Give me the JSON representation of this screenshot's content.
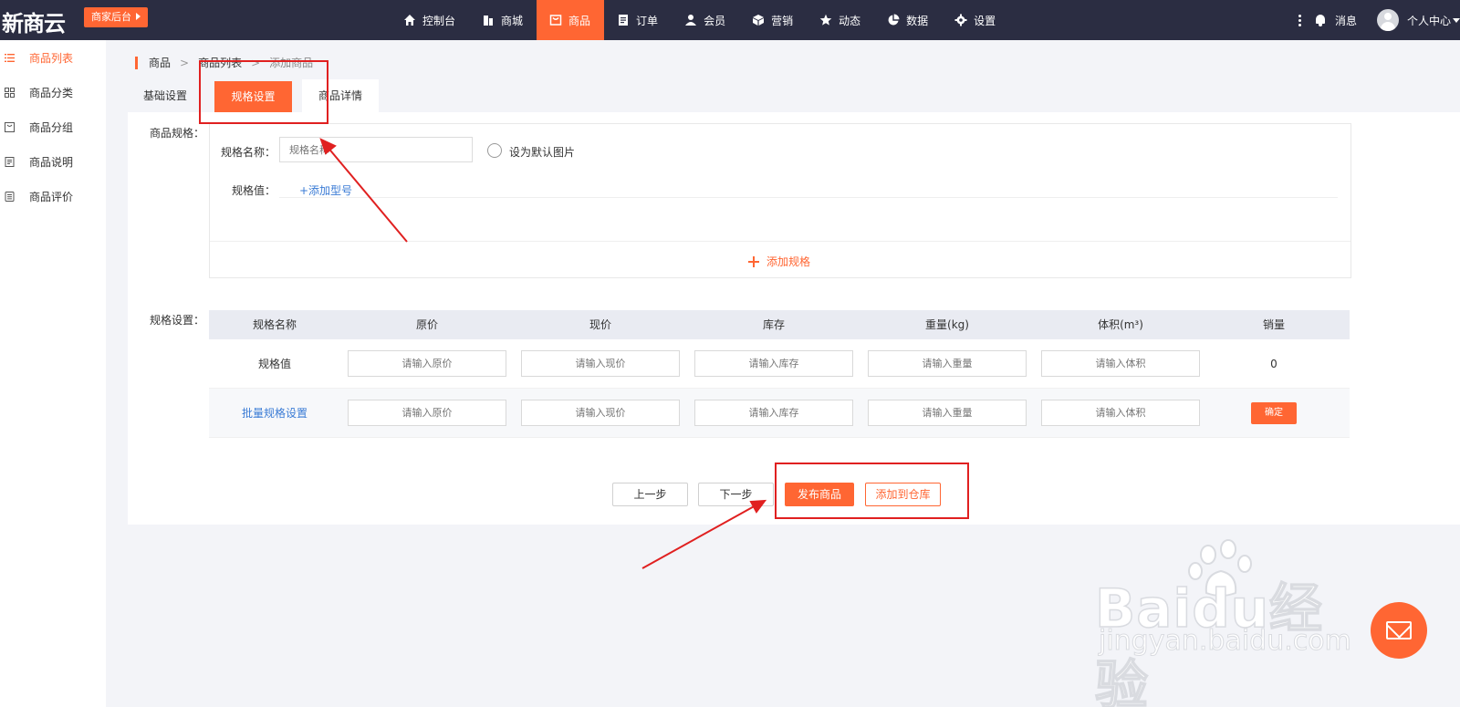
{
  "header": {
    "logo": "新商云",
    "merchant_button": "商家后台",
    "nav": [
      {
        "label": "控制台",
        "icon": "home-icon"
      },
      {
        "label": "商城",
        "icon": "building-icon"
      },
      {
        "label": "商品",
        "icon": "bag-icon",
        "active": true
      },
      {
        "label": "订单",
        "icon": "clipboard-icon"
      },
      {
        "label": "会员",
        "icon": "user-icon"
      },
      {
        "label": "营销",
        "icon": "cube-icon"
      },
      {
        "label": "动态",
        "icon": "star-icon"
      },
      {
        "label": "数据",
        "icon": "pie-chart-icon"
      },
      {
        "label": "设置",
        "icon": "gear-icon"
      }
    ],
    "messages_label": "消息",
    "user_center_label": "个人中心"
  },
  "sidebar": {
    "items": [
      {
        "label": "商品列表",
        "icon": "list-icon",
        "active": true
      },
      {
        "label": "商品分类",
        "icon": "grid-icon"
      },
      {
        "label": "商品分组",
        "icon": "folder-icon"
      },
      {
        "label": "商品说明",
        "icon": "document-icon"
      },
      {
        "label": "商品评价",
        "icon": "review-icon"
      }
    ]
  },
  "breadcrumb": [
    "商品",
    ">",
    "商品列表",
    ">",
    "添加商品"
  ],
  "tabs": [
    "基础设置",
    "规格设置",
    "商品详情"
  ],
  "spec": {
    "section_label": "商品规格：",
    "name_label": "规格名称：",
    "name_placeholder": "规格名称",
    "default_image_label": "设为默认图片",
    "value_label": "规格值：",
    "add_model_link": "+添加型号",
    "add_spec_label": "添加规格"
  },
  "spec_settings": {
    "section_label": "规格设置：",
    "columns": [
      "规格名称",
      "原价",
      "现价",
      "库存",
      "重量(kg)",
      "体积(m³)",
      "销量"
    ],
    "rows": [
      {
        "name": "规格值",
        "placeholders": [
          "请输入原价",
          "请输入现价",
          "请输入库存",
          "请输入重量",
          "请输入体积"
        ],
        "sales": "0"
      },
      {
        "name": "批量规格设置",
        "placeholders": [
          "请输入原价",
          "请输入现价",
          "请输入库存",
          "请输入重量",
          "请输入体积"
        ],
        "confirm_label": "确定"
      }
    ]
  },
  "actions": {
    "prev": "上一步",
    "next": "下一步",
    "publish": "发布商品",
    "add_to_warehouse": "添加到仓库"
  },
  "watermark": {
    "brand": "Baidu经验",
    "url": "jingyan.baidu.com"
  },
  "colors": {
    "accent": "#ff6633",
    "topbar": "#2b2d42",
    "link": "#3a7bd5",
    "annotation": "#e02020"
  }
}
